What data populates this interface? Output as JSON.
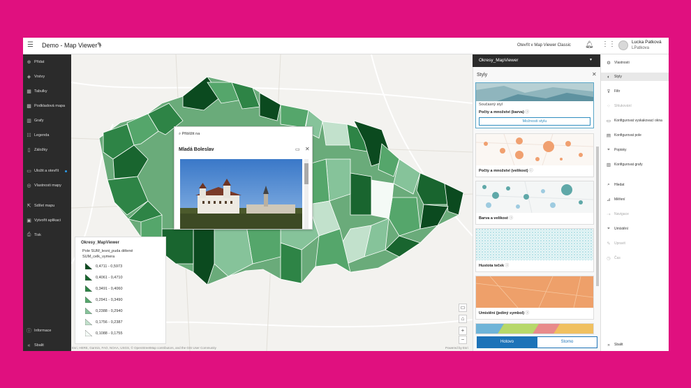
{
  "header": {
    "title": "Demo - Map Viewer I",
    "classic_link": "Otevřít v Map Viewer Classic",
    "user_name": "Lucka Patková",
    "user_login": "LPatkova"
  },
  "left_toolbar": [
    {
      "label": "Přidat",
      "icon": "plus-circle-icon"
    },
    {
      "label": "Vrstvy",
      "icon": "layers-icon"
    },
    {
      "label": "Tabulky",
      "icon": "table-icon"
    },
    {
      "label": "Podkladová mapa",
      "icon": "basemap-icon"
    },
    {
      "label": "Grafy",
      "icon": "chart-icon"
    },
    {
      "label": "Legenda",
      "icon": "legend-icon"
    },
    {
      "label": "Záložky",
      "icon": "bookmark-icon"
    },
    {
      "label": "Uložit a otevřít",
      "icon": "folder-icon"
    },
    {
      "label": "Vlastnosti mapy",
      "icon": "map-properties-icon"
    },
    {
      "label": "Sdílet mapu",
      "icon": "share-icon"
    },
    {
      "label": "Vytvořit aplikaci",
      "icon": "create-app-icon"
    },
    {
      "label": "Tisk",
      "icon": "print-icon"
    },
    {
      "label": "Informace",
      "icon": "info-icon"
    },
    {
      "label": "Sbalit",
      "icon": "collapse-icon"
    }
  ],
  "popup": {
    "zoom_to": "Přiblížit na",
    "title": "Mladá Boleslav"
  },
  "legend": {
    "layer": "Okresy_MapViewer",
    "field": "Pole SUM_lesni_puda dělené SUM_celk_vymera",
    "classes": [
      {
        "label": "0,4711 - 0,5973",
        "color": "#0b4a1f"
      },
      {
        "label": "0,4061 - 0,4710",
        "color": "#19652f"
      },
      {
        "label": "0,3491 - 0,4060",
        "color": "#2e8446"
      },
      {
        "label": "0,2941 - 0,3490",
        "color": "#55a66b"
      },
      {
        "label": "0,2388 - 0,2940",
        "color": "#86c39a"
      },
      {
        "label": "0,1756 - 0,2387",
        "color": "#c2e1cc"
      },
      {
        "label": "0,1088 - 0,1755",
        "color": "#f4faf6"
      }
    ]
  },
  "map": {
    "attribution": "Esri, HERE, Garmin, FAO, NOAA, USGS, © OpenStreetMap contributors, and the GIS User Community",
    "powered_by": "Powered by Esri"
  },
  "layer_header": {
    "name": "Okresy_MapViewer"
  },
  "styles_panel": {
    "heading": "Styly",
    "current_label": "Současný styl",
    "current_style": "Počty a množství (barva)",
    "options_button": "Možnosti stylu",
    "cards": [
      "Počty a množství (velikost)",
      "Barva a velikost",
      "Hustota teček",
      "Umístění (jediný symbol)"
    ],
    "done": "Hotovo",
    "cancel": "Storno"
  },
  "right_toolbar": [
    {
      "label": "Vlastnosti",
      "icon": "properties-icon",
      "state": "normal"
    },
    {
      "label": "Styly",
      "icon": "styles-icon",
      "state": "active"
    },
    {
      "label": "Filtr",
      "icon": "filter-icon",
      "state": "normal"
    },
    {
      "label": "Shlukování",
      "icon": "clustering-icon",
      "state": "disabled"
    },
    {
      "label": "Konfigurovat vyskakovací okna",
      "icon": "popup-config-icon",
      "state": "normal"
    },
    {
      "label": "Konfigurovat pole",
      "icon": "fields-icon",
      "state": "normal"
    },
    {
      "label": "Popisky",
      "icon": "labels-icon",
      "state": "normal"
    },
    {
      "label": "Konfigurovat grafy",
      "icon": "chart-config-icon",
      "state": "normal"
    },
    {
      "label": "Hledat",
      "icon": "search-icon",
      "state": "normal"
    },
    {
      "label": "Měření",
      "icon": "measure-icon",
      "state": "normal"
    },
    {
      "label": "Navigace",
      "icon": "directions-icon",
      "state": "disabled"
    },
    {
      "label": "Umístění",
      "icon": "location-icon",
      "state": "normal"
    },
    {
      "label": "Upravit",
      "icon": "edit-icon",
      "state": "disabled"
    },
    {
      "label": "Čas",
      "icon": "clock-icon",
      "state": "disabled"
    },
    {
      "label": "Sbalit",
      "icon": "expand-icon",
      "state": "normal"
    }
  ],
  "colors": {
    "accent": "#1d73b8",
    "toolbar_dark": "#2b2b2b",
    "page_bg": "#e0107f"
  }
}
